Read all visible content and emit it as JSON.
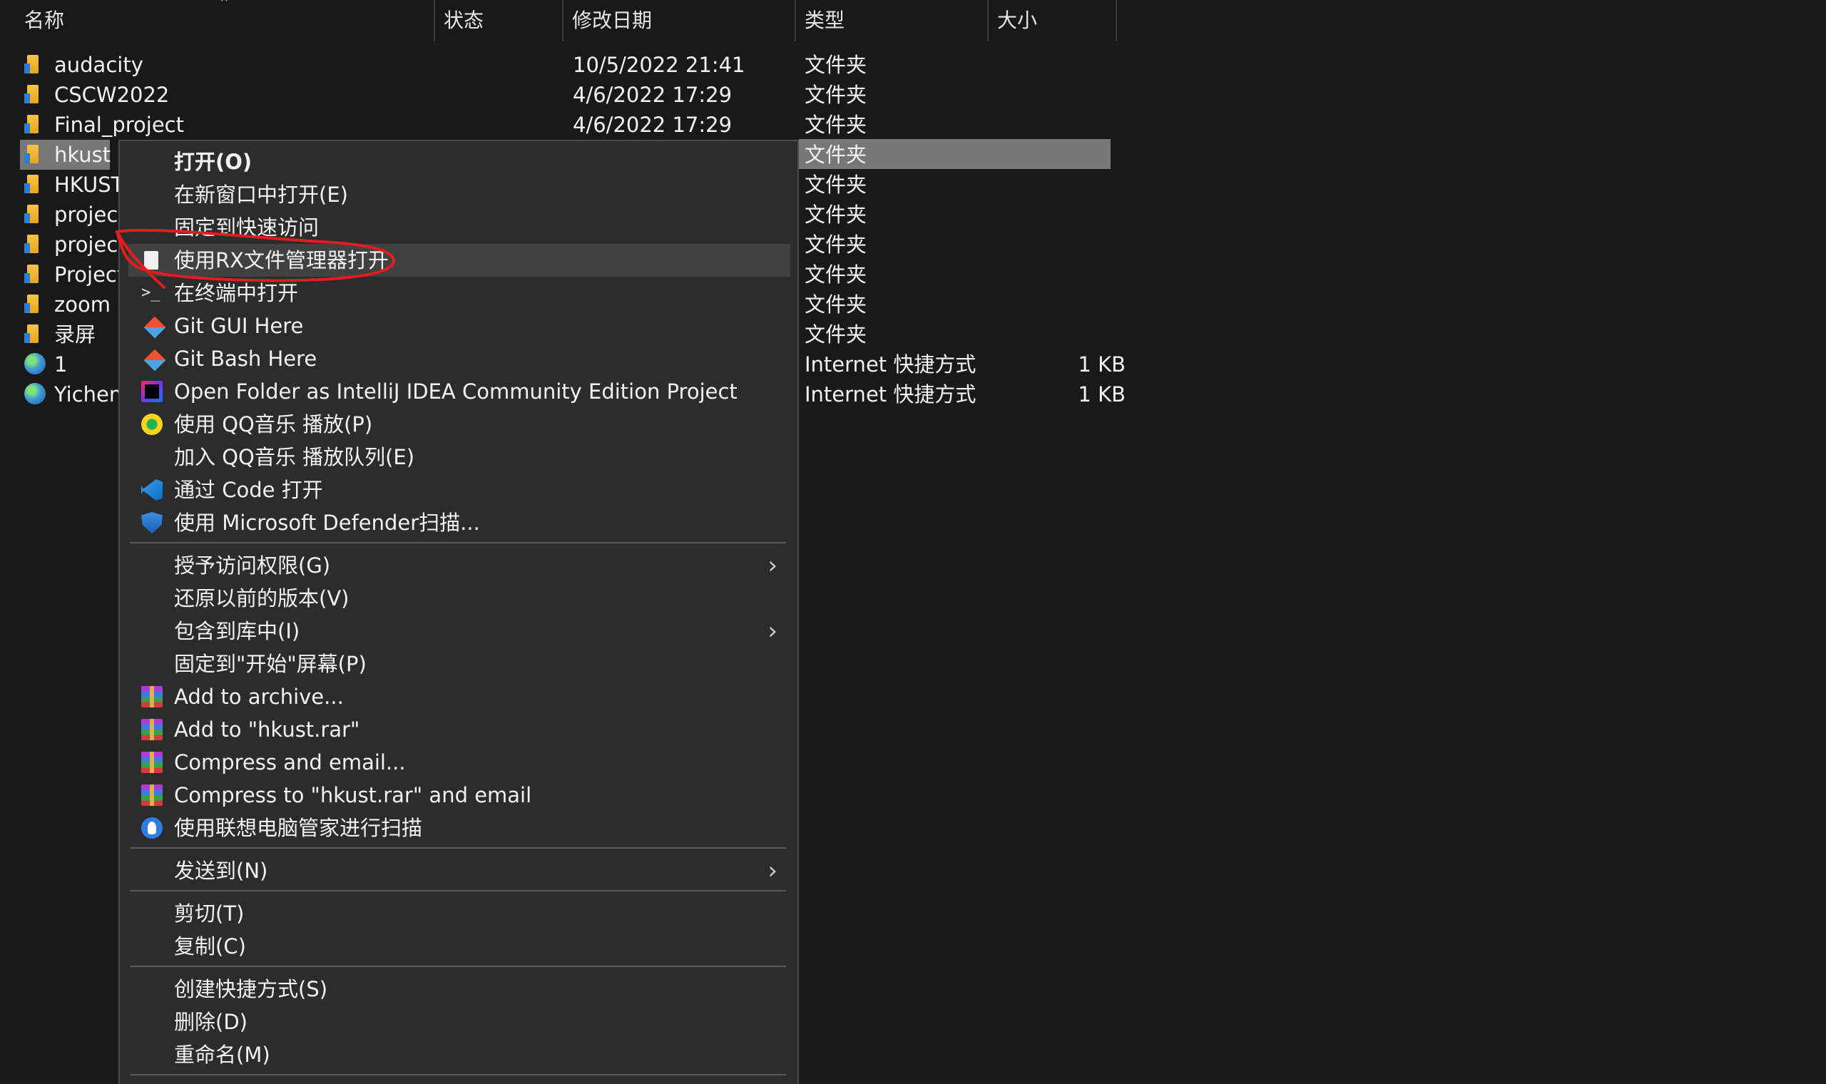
{
  "columns": {
    "name": "名称",
    "status": "状态",
    "date": "修改日期",
    "type": "类型",
    "size": "大小"
  },
  "files": [
    {
      "name": "audacity",
      "date": "10/5/2022 21:41",
      "type": "文件夹",
      "size": "",
      "icon": "folder-icon"
    },
    {
      "name": "CSCW2022",
      "date": "4/6/2022 17:29",
      "type": "文件夹",
      "size": "",
      "icon": "folder-icon"
    },
    {
      "name": "Final_project",
      "date": "4/6/2022 17:29",
      "type": "文件夹",
      "size": "",
      "icon": "folder-icon"
    },
    {
      "name": "hkust",
      "date": "",
      "type": "文件夹",
      "size": "",
      "icon": "folder-icon",
      "selected": true
    },
    {
      "name": "HKUST",
      "date": "",
      "type": "文件夹",
      "size": "",
      "icon": "folder-icon"
    },
    {
      "name": "project",
      "date": "",
      "type": "文件夹",
      "size": "",
      "icon": "folder-icon"
    },
    {
      "name": "projec",
      "date": "",
      "type": "文件夹",
      "size": "",
      "icon": "folder-icon"
    },
    {
      "name": "Project",
      "date": "",
      "type": "文件夹",
      "size": "",
      "icon": "folder-icon"
    },
    {
      "name": "zoom r",
      "date": "",
      "type": "文件夹",
      "size": "",
      "icon": "folder-icon"
    },
    {
      "name": "录屏",
      "date": "",
      "type": "文件夹",
      "size": "",
      "icon": "folder-icon"
    },
    {
      "name": "1",
      "date": "",
      "type": "Internet 快捷方式",
      "size": "1 KB",
      "icon": "globe-icon"
    },
    {
      "name": "Yichen",
      "date": "",
      "type": "Internet 快捷方式",
      "size": "1 KB",
      "icon": "globe-icon"
    }
  ],
  "context_menu": {
    "items": [
      {
        "label": "打开(O)",
        "bold": true,
        "icon": ""
      },
      {
        "label": "在新窗口中打开(E)",
        "icon": ""
      },
      {
        "label": "固定到快速访问",
        "icon": ""
      },
      {
        "label": "使用RX文件管理器打开",
        "icon": "document-icon",
        "hover": true
      },
      {
        "label": "在终端中打开",
        "icon": "terminal-icon"
      },
      {
        "label": "Git GUI Here",
        "icon": "git-icon"
      },
      {
        "label": "Git Bash Here",
        "icon": "git-icon"
      },
      {
        "label": "Open Folder as IntelliJ IDEA Community Edition Project",
        "icon": "intellij-icon"
      },
      {
        "label": "使用 QQ音乐 播放(P)",
        "icon": "qq-music-icon"
      },
      {
        "label": "加入 QQ音乐 播放队列(E)",
        "icon": ""
      },
      {
        "label": "通过 Code 打开",
        "icon": "vscode-icon"
      },
      {
        "label": "使用 Microsoft Defender扫描...",
        "icon": "defender-icon"
      },
      {
        "label": "授予访问权限(G)",
        "icon": "",
        "submenu": true
      },
      {
        "label": "还原以前的版本(V)",
        "icon": ""
      },
      {
        "label": "包含到库中(I)",
        "icon": "",
        "submenu": true
      },
      {
        "label": "固定到\"开始\"屏幕(P)",
        "icon": ""
      },
      {
        "label": "Add to archive...",
        "icon": "winrar-icon"
      },
      {
        "label": "Add to \"hkust.rar\"",
        "icon": "winrar-icon"
      },
      {
        "label": "Compress and email...",
        "icon": "winrar-icon"
      },
      {
        "label": "Compress to \"hkust.rar\" and email",
        "icon": "winrar-icon"
      },
      {
        "label": "使用联想电脑管家进行扫描",
        "icon": "lenovo-icon"
      },
      {
        "label": "发送到(N)",
        "icon": "",
        "submenu": true
      },
      {
        "label": "剪切(T)",
        "icon": ""
      },
      {
        "label": "复制(C)",
        "icon": ""
      },
      {
        "label": "创建快捷方式(S)",
        "icon": ""
      },
      {
        "label": "删除(D)",
        "icon": ""
      },
      {
        "label": "重命名(M)",
        "icon": ""
      }
    ]
  },
  "colors": {
    "background": "#191919",
    "menu_bg": "#2c2c2c",
    "selection": "#777777",
    "hover": "#414141",
    "annotation": "#e01e1e"
  }
}
